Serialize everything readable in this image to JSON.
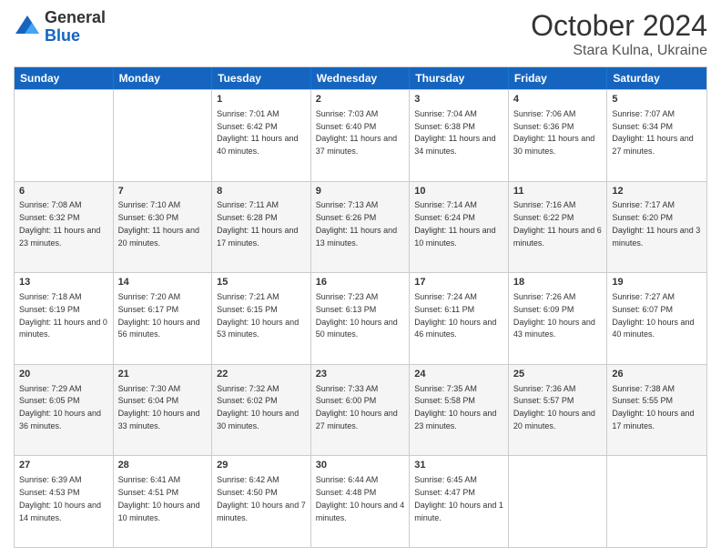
{
  "header": {
    "logo_general": "General",
    "logo_blue": "Blue",
    "title": "October 2024",
    "location": "Stara Kulna, Ukraine"
  },
  "weekdays": [
    "Sunday",
    "Monday",
    "Tuesday",
    "Wednesday",
    "Thursday",
    "Friday",
    "Saturday"
  ],
  "rows": [
    [
      {
        "day": "",
        "info": ""
      },
      {
        "day": "",
        "info": ""
      },
      {
        "day": "1",
        "info": "Sunrise: 7:01 AM\nSunset: 6:42 PM\nDaylight: 11 hours and 40 minutes."
      },
      {
        "day": "2",
        "info": "Sunrise: 7:03 AM\nSunset: 6:40 PM\nDaylight: 11 hours and 37 minutes."
      },
      {
        "day": "3",
        "info": "Sunrise: 7:04 AM\nSunset: 6:38 PM\nDaylight: 11 hours and 34 minutes."
      },
      {
        "day": "4",
        "info": "Sunrise: 7:06 AM\nSunset: 6:36 PM\nDaylight: 11 hours and 30 minutes."
      },
      {
        "day": "5",
        "info": "Sunrise: 7:07 AM\nSunset: 6:34 PM\nDaylight: 11 hours and 27 minutes."
      }
    ],
    [
      {
        "day": "6",
        "info": "Sunrise: 7:08 AM\nSunset: 6:32 PM\nDaylight: 11 hours and 23 minutes."
      },
      {
        "day": "7",
        "info": "Sunrise: 7:10 AM\nSunset: 6:30 PM\nDaylight: 11 hours and 20 minutes."
      },
      {
        "day": "8",
        "info": "Sunrise: 7:11 AM\nSunset: 6:28 PM\nDaylight: 11 hours and 17 minutes."
      },
      {
        "day": "9",
        "info": "Sunrise: 7:13 AM\nSunset: 6:26 PM\nDaylight: 11 hours and 13 minutes."
      },
      {
        "day": "10",
        "info": "Sunrise: 7:14 AM\nSunset: 6:24 PM\nDaylight: 11 hours and 10 minutes."
      },
      {
        "day": "11",
        "info": "Sunrise: 7:16 AM\nSunset: 6:22 PM\nDaylight: 11 hours and 6 minutes."
      },
      {
        "day": "12",
        "info": "Sunrise: 7:17 AM\nSunset: 6:20 PM\nDaylight: 11 hours and 3 minutes."
      }
    ],
    [
      {
        "day": "13",
        "info": "Sunrise: 7:18 AM\nSunset: 6:19 PM\nDaylight: 11 hours and 0 minutes."
      },
      {
        "day": "14",
        "info": "Sunrise: 7:20 AM\nSunset: 6:17 PM\nDaylight: 10 hours and 56 minutes."
      },
      {
        "day": "15",
        "info": "Sunrise: 7:21 AM\nSunset: 6:15 PM\nDaylight: 10 hours and 53 minutes."
      },
      {
        "day": "16",
        "info": "Sunrise: 7:23 AM\nSunset: 6:13 PM\nDaylight: 10 hours and 50 minutes."
      },
      {
        "day": "17",
        "info": "Sunrise: 7:24 AM\nSunset: 6:11 PM\nDaylight: 10 hours and 46 minutes."
      },
      {
        "day": "18",
        "info": "Sunrise: 7:26 AM\nSunset: 6:09 PM\nDaylight: 10 hours and 43 minutes."
      },
      {
        "day": "19",
        "info": "Sunrise: 7:27 AM\nSunset: 6:07 PM\nDaylight: 10 hours and 40 minutes."
      }
    ],
    [
      {
        "day": "20",
        "info": "Sunrise: 7:29 AM\nSunset: 6:05 PM\nDaylight: 10 hours and 36 minutes."
      },
      {
        "day": "21",
        "info": "Sunrise: 7:30 AM\nSunset: 6:04 PM\nDaylight: 10 hours and 33 minutes."
      },
      {
        "day": "22",
        "info": "Sunrise: 7:32 AM\nSunset: 6:02 PM\nDaylight: 10 hours and 30 minutes."
      },
      {
        "day": "23",
        "info": "Sunrise: 7:33 AM\nSunset: 6:00 PM\nDaylight: 10 hours and 27 minutes."
      },
      {
        "day": "24",
        "info": "Sunrise: 7:35 AM\nSunset: 5:58 PM\nDaylight: 10 hours and 23 minutes."
      },
      {
        "day": "25",
        "info": "Sunrise: 7:36 AM\nSunset: 5:57 PM\nDaylight: 10 hours and 20 minutes."
      },
      {
        "day": "26",
        "info": "Sunrise: 7:38 AM\nSunset: 5:55 PM\nDaylight: 10 hours and 17 minutes."
      }
    ],
    [
      {
        "day": "27",
        "info": "Sunrise: 6:39 AM\nSunset: 4:53 PM\nDaylight: 10 hours and 14 minutes."
      },
      {
        "day": "28",
        "info": "Sunrise: 6:41 AM\nSunset: 4:51 PM\nDaylight: 10 hours and 10 minutes."
      },
      {
        "day": "29",
        "info": "Sunrise: 6:42 AM\nSunset: 4:50 PM\nDaylight: 10 hours and 7 minutes."
      },
      {
        "day": "30",
        "info": "Sunrise: 6:44 AM\nSunset: 4:48 PM\nDaylight: 10 hours and 4 minutes."
      },
      {
        "day": "31",
        "info": "Sunrise: 6:45 AM\nSunset: 4:47 PM\nDaylight: 10 hours and 1 minute."
      },
      {
        "day": "",
        "info": ""
      },
      {
        "day": "",
        "info": ""
      }
    ]
  ]
}
